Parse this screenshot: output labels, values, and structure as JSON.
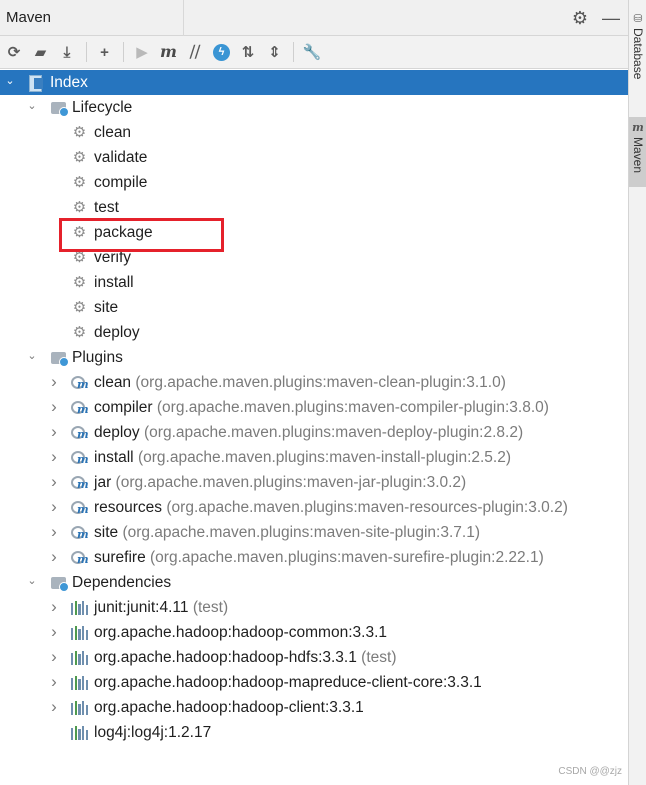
{
  "window": {
    "title": "Maven"
  },
  "header_actions": [
    {
      "name": "settings-gear-icon",
      "glyph": "⚙"
    },
    {
      "name": "minimize-icon",
      "glyph": "—"
    }
  ],
  "toolbar": [
    {
      "name": "reload-icon",
      "glyph": "⟳",
      "enabled": true
    },
    {
      "name": "add-maven-project-icon",
      "glyph": "▰",
      "enabled": true
    },
    {
      "name": "download-sources-icon",
      "glyph": "⤓",
      "enabled": true
    },
    {
      "sep": true
    },
    {
      "name": "add-icon",
      "glyph": "+",
      "enabled": true
    },
    {
      "sep": true
    },
    {
      "name": "run-icon",
      "glyph": "▶",
      "enabled": false
    },
    {
      "name": "execute-maven-goal-icon",
      "glyph": "m",
      "enabled": true
    },
    {
      "name": "toggle-offline-icon",
      "glyph": "⧸⧸",
      "enabled": true
    },
    {
      "name": "skip-tests-icon",
      "glyph": "ϟ",
      "enabled": true
    },
    {
      "name": "show-dependencies-icon",
      "glyph": "⇅",
      "enabled": true
    },
    {
      "name": "collapse-all-icon",
      "glyph": "⇕",
      "enabled": true
    },
    {
      "sep": true
    },
    {
      "name": "maven-settings-wrench-icon",
      "glyph": "🔧",
      "enabled": true
    }
  ],
  "side_tabs": [
    {
      "label": "Database",
      "icon": "database-icon"
    },
    {
      "label": "Maven",
      "icon": "maven-icon"
    }
  ],
  "tree": {
    "root": {
      "label": "Index",
      "expanded": true
    },
    "lifecycle": {
      "label": "Lifecycle",
      "goals": [
        "clean",
        "validate",
        "compile",
        "test",
        "package",
        "verify",
        "install",
        "site",
        "deploy"
      ]
    },
    "plugins": {
      "label": "Plugins",
      "items": [
        {
          "name": "clean",
          "detail": "(org.apache.maven.plugins:maven-clean-plugin:3.1.0)"
        },
        {
          "name": "compiler",
          "detail": "(org.apache.maven.plugins:maven-compiler-plugin:3.8.0)"
        },
        {
          "name": "deploy",
          "detail": "(org.apache.maven.plugins:maven-deploy-plugin:2.8.2)"
        },
        {
          "name": "install",
          "detail": "(org.apache.maven.plugins:maven-install-plugin:2.5.2)"
        },
        {
          "name": "jar",
          "detail": "(org.apache.maven.plugins:maven-jar-plugin:3.0.2)"
        },
        {
          "name": "resources",
          "detail": "(org.apache.maven.plugins:maven-resources-plugin:3.0.2)"
        },
        {
          "name": "site",
          "detail": "(org.apache.maven.plugins:maven-site-plugin:3.7.1)"
        },
        {
          "name": "surefire",
          "detail": "(org.apache.maven.plugins:maven-surefire-plugin:2.22.1)"
        }
      ]
    },
    "dependencies": {
      "label": "Dependencies",
      "items": [
        {
          "name": "junit:junit:4.11",
          "detail": "(test)",
          "expandable": true
        },
        {
          "name": "org.apache.hadoop:hadoop-common:3.3.1",
          "detail": "",
          "expandable": true
        },
        {
          "name": "org.apache.hadoop:hadoop-hdfs:3.3.1",
          "detail": "(test)",
          "expandable": true
        },
        {
          "name": "org.apache.hadoop:hadoop-mapreduce-client-core:3.3.1",
          "detail": "",
          "expandable": true
        },
        {
          "name": "org.apache.hadoop:hadoop-client:3.3.1",
          "detail": "",
          "expandable": true
        },
        {
          "name": "log4j:log4j:1.2.17",
          "detail": "",
          "expandable": false
        }
      ]
    }
  },
  "annotation": {
    "highlighted_goal": "package",
    "highlight_color": "#e5212b"
  },
  "watermark": "CSDN @@zjz",
  "colors": {
    "selection": "#2675bf",
    "detail_text": "#7b7b7b",
    "accent": "#3a95d4"
  }
}
